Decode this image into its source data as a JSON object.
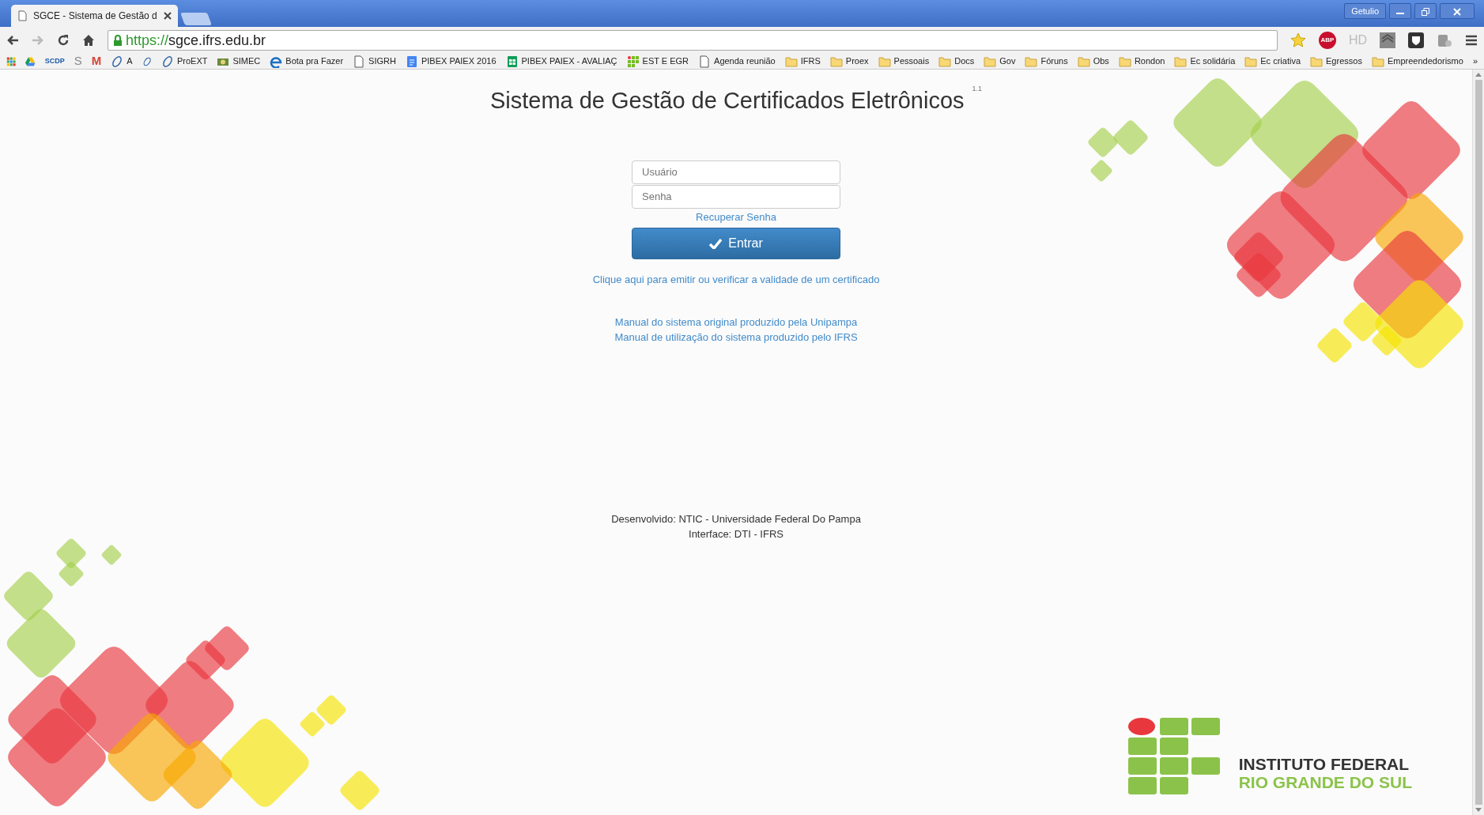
{
  "browser": {
    "tab": {
      "title": "SGCE - Sistema de Gestão d",
      "selected": true
    },
    "profile": "Getulio",
    "address": {
      "scheme": "https://",
      "host": "sgce.ifrs.edu.br"
    },
    "extensions": [
      {
        "kind": "star"
      },
      {
        "kind": "abp",
        "label": "ABP"
      },
      {
        "kind": "hd",
        "label": "HD"
      },
      {
        "kind": "layers"
      },
      {
        "kind": "shield"
      },
      {
        "kind": "puzzle"
      }
    ],
    "bookmarks": [
      {
        "kind": "apps"
      },
      {
        "kind": "drive"
      },
      {
        "kind": "scdp",
        "label": "SCDP"
      },
      {
        "kind": "letter",
        "label": "S"
      },
      {
        "kind": "gmail",
        "label": "M"
      },
      {
        "kind": "ring",
        "label": "A"
      },
      {
        "kind": "ring"
      },
      {
        "kind": "ring",
        "label": "ProEXT"
      },
      {
        "kind": "simec",
        "label": "SIMEC"
      },
      {
        "kind": "e",
        "label": "Bota pra Fazer"
      },
      {
        "kind": "page",
        "label": "SIGRH"
      },
      {
        "kind": "doc",
        "label": "PIBEX PAIEX 2016"
      },
      {
        "kind": "sheet",
        "label": "PIBEX PAIEX - AVALIAÇ"
      },
      {
        "kind": "ifrs",
        "label": "EST E EGR"
      },
      {
        "kind": "page",
        "label": "Agenda reunião"
      },
      {
        "kind": "folder",
        "label": "IFRS"
      },
      {
        "kind": "folder",
        "label": "Proex"
      },
      {
        "kind": "folder",
        "label": "Pessoais"
      },
      {
        "kind": "folder",
        "label": "Docs"
      },
      {
        "kind": "folder",
        "label": "Gov"
      },
      {
        "kind": "folder",
        "label": "Fóruns"
      },
      {
        "kind": "folder",
        "label": "Obs"
      },
      {
        "kind": "folder",
        "label": "Rondon"
      },
      {
        "kind": "folder",
        "label": "Ec solidária"
      },
      {
        "kind": "folder",
        "label": "Ec criativa"
      },
      {
        "kind": "folder",
        "label": "Egressos"
      },
      {
        "kind": "folder",
        "label": "Empreendedorismo"
      }
    ],
    "overflow": "»"
  },
  "page": {
    "title": "Sistema de Gestão de Certificados Eletrônicos",
    "version": "1.1",
    "login": {
      "username": {
        "placeholder": "Usuário"
      },
      "password": {
        "placeholder": "Senha"
      },
      "recover_link": "Recuperar Senha",
      "submit": "Entrar"
    },
    "certificate_link": "Clique aqui para emitir ou verificar a validade de um certificado",
    "manual_links": [
      "Manual do sistema original produzido pela Unipampa",
      "Manual de utilização do sistema produzido pelo IFRS"
    ],
    "footer": [
      "Desenvolvido: NTIC - Universidade Federal Do Pampa",
      "Interface: DTI - IFRS"
    ],
    "logo": {
      "line_1": "INSTITUTO FEDERAL",
      "line_2": "RIO GRANDE DO SUL"
    }
  }
}
